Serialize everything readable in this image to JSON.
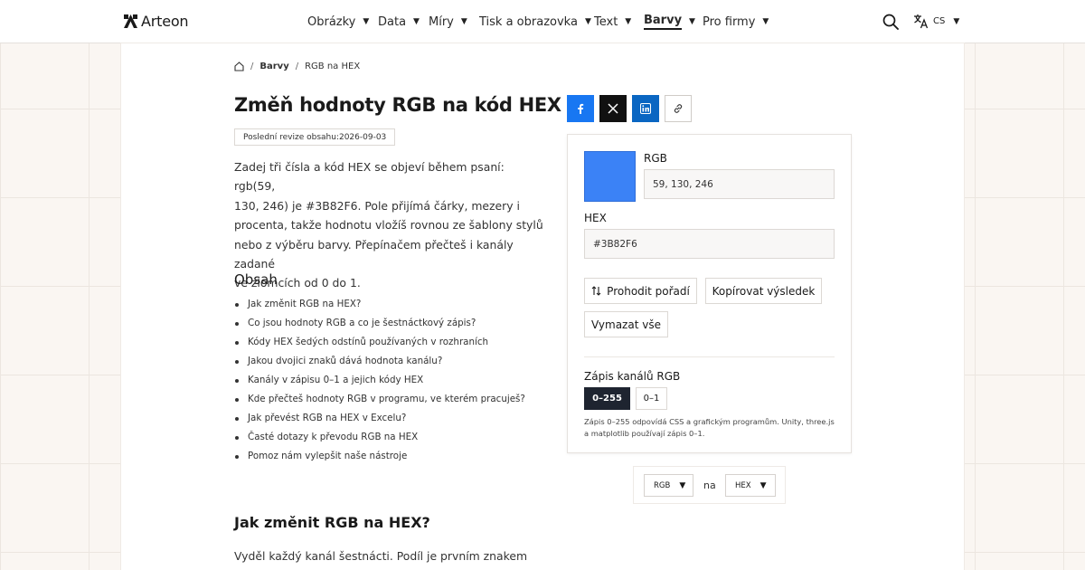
{
  "header": {
    "logo_text": "Arteon",
    "nav": [
      {
        "label": "Obrázky",
        "active": false
      },
      {
        "label": "Data",
        "active": false
      },
      {
        "label": "Míry",
        "active": false
      },
      {
        "label": "Tisk a obrazovka",
        "active": false
      },
      {
        "label": "Text",
        "active": false
      },
      {
        "label": "Barvy",
        "active": true
      },
      {
        "label": "Pro firmy",
        "active": false
      }
    ],
    "language": "CS"
  },
  "breadcrumb": {
    "section": "Barvy",
    "current": "RGB na HEX"
  },
  "article": {
    "title": "Změň hodnoty RGB na kód HEX",
    "revision": "Poslední revize obsahu:2026-09-03",
    "intro_lines": [
      "Zadej tři čísla a kód HEX se objeví během psaní: rgb(59,",
      "130, 246) je #3B82F6. Pole přijímá čárky, mezery i",
      "procenta, takže hodnotu vložíš rovnou ze šablony stylů",
      "nebo z výběru barvy. Přepínačem přečteš i kanály zadané",
      "ve zlomcích od 0 do 1."
    ],
    "toc_title": "Obsah",
    "toc": [
      "Jak změnit RGB na HEX?",
      "Co jsou hodnoty RGB a co je šestnáctkový zápis?",
      "Kódy HEX šedých odstínů používaných v rozhraních",
      "Jakou dvojici znaků dává hodnota kanálu?",
      "Kanály v zápisu 0–1 a jejich kódy HEX",
      "Kde přečteš hodnoty RGB v programu, ve kterém pracuješ?",
      "Jak převést RGB na HEX v Excelu?",
      "Časté dotazy k převodu RGB na HEX",
      "Pomoz nám vylepšit naše nástroje"
    ],
    "section_title": "Jak změnit RGB na HEX?",
    "section_text": "Vyděl každý kanál šestnácti. Podíl je prvním znakem"
  },
  "converter": {
    "swatch_color": "#3B82F6",
    "rgb_label": "RGB",
    "rgb_value": "59, 130, 246",
    "hex_label": "HEX",
    "hex_value": "#3B82F6",
    "swap_label": "Prohodit pořadí",
    "copy_label": "Kopírovat výsledek",
    "clear_label": "Vymazat vše",
    "mode_title": "Zápis kanálů RGB",
    "mode_options": [
      "0–255",
      "0–1"
    ],
    "mode_selected": "0–255",
    "note": "Zápis 0–255 odpovídá CSS a grafickým programům. Unity, three.js a matplotlib používají zápis 0–1."
  },
  "direction": {
    "from": "RGB",
    "separator": "na",
    "to": "HEX"
  },
  "colors": {
    "accent_dark": "#1E2430",
    "facebook": "#1877F2",
    "linkedin": "#0A66C2",
    "x": "#111111"
  }
}
